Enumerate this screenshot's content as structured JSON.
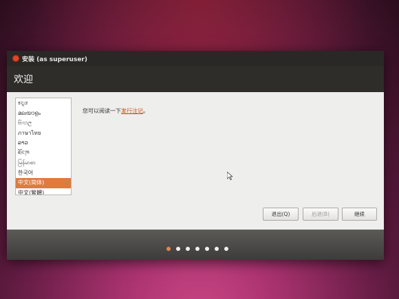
{
  "window": {
    "title": "安装 (as superuser)",
    "page_title": "欢迎"
  },
  "languages": [
    "ಕನ್ನಡ",
    "മലയാളം",
    "සිංහල",
    "ภาษาไทย",
    "ລາວ",
    "ཇོང་ཁ",
    "မြန်မာစာ",
    "한국어",
    "中文(简体)",
    "中文(繁體)"
  ],
  "selected_language": "中文(简体)",
  "release_notes": {
    "prefix": "您可以阅读一下",
    "link": "发行注记",
    "suffix": "。"
  },
  "buttons": {
    "quit": "退出(Q)",
    "back": "后退(B)",
    "continue": "继续"
  },
  "progress": {
    "total_steps": 7,
    "current_step": 1
  },
  "colors": {
    "accent": "#e07a3e",
    "link": "#d24a12",
    "close": "#e0452b"
  }
}
